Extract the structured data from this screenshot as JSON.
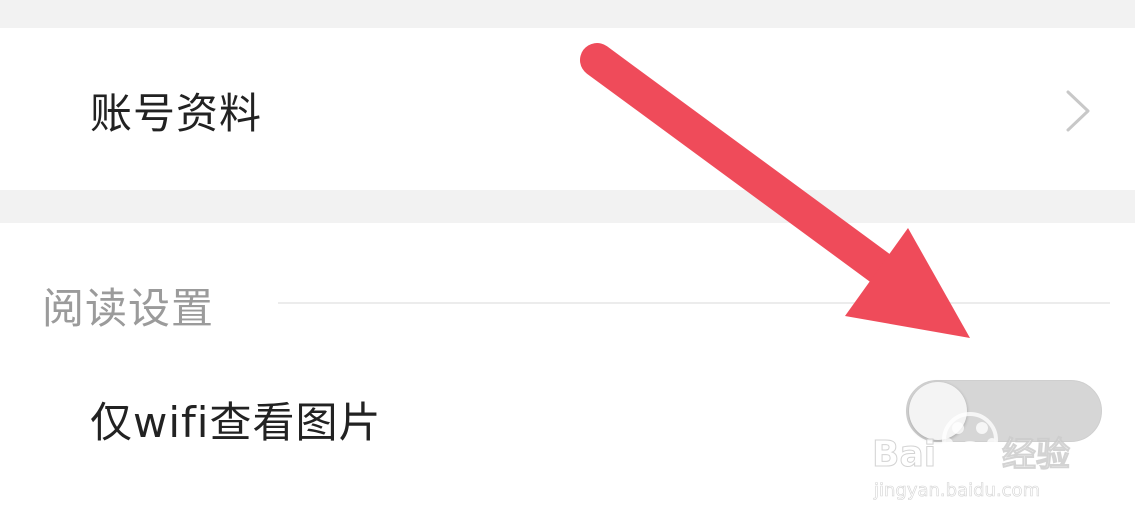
{
  "account": {
    "label": "账号资料",
    "chevron_icon": "chevron-right-icon"
  },
  "reading_settings": {
    "title": "阅读设置",
    "wifi_images": {
      "label": "仅wifi查看图片",
      "toggle_on": false
    }
  },
  "annotation": {
    "arrow_color": "#ef4b5a"
  },
  "watermark": {
    "brand": "Baidu经验",
    "url": "jingyan.baidu.com"
  },
  "colors": {
    "background": "#f2f2f2",
    "card": "#ffffff",
    "primary_text": "#222222",
    "secondary_text": "#9b9b9b",
    "toggle_off": "#d6d6d6"
  }
}
